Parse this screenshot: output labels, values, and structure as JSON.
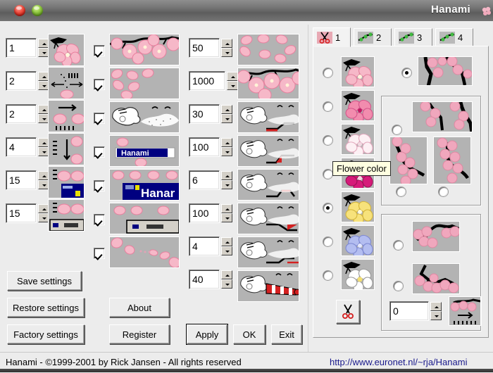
{
  "window": {
    "title": "Hanami",
    "close_label": "close",
    "minimize_label": "minimize"
  },
  "left_column": {
    "spinners": [
      {
        "name": "flowers-per-branch",
        "value": "1"
      },
      {
        "name": "wind-direction",
        "value": "2"
      },
      {
        "name": "horizontal-speed",
        "value": "2"
      },
      {
        "name": "vertical-speed",
        "value": "4"
      },
      {
        "name": "petal-size-min",
        "value": "15"
      },
      {
        "name": "petal-size-max",
        "value": "15"
      }
    ]
  },
  "middle_column": {
    "checkboxes": [
      {
        "name": "show-branches",
        "checked": true
      },
      {
        "name": "show-falling-petals",
        "checked": true
      },
      {
        "name": "show-clouds",
        "checked": true
      },
      {
        "name": "petals-on-titlebar",
        "checked": true
      },
      {
        "name": "petals-on-windows",
        "checked": true
      },
      {
        "name": "petals-on-taskbar",
        "checked": true
      },
      {
        "name": "petals-trail",
        "checked": true
      }
    ]
  },
  "right_column": {
    "spinners": [
      {
        "name": "petal-count",
        "value": "50"
      },
      {
        "name": "flower-count",
        "value": "1000"
      },
      {
        "name": "wind-gust-chance",
        "value": "30"
      },
      {
        "name": "wind-strength",
        "value": "100"
      },
      {
        "name": "gust-duration",
        "value": "6"
      },
      {
        "name": "turbulence",
        "value": "100"
      },
      {
        "name": "cloud-speed",
        "value": "4"
      },
      {
        "name": "blow-strength",
        "value": "40"
      }
    ]
  },
  "buttons": {
    "save_settings": "Save settings",
    "restore_settings": "Restore settings",
    "factory_settings": "Factory settings",
    "about": "About",
    "register": "Register",
    "apply": "Apply",
    "ok": "OK",
    "exit": "Exit"
  },
  "tabs": [
    {
      "label": "1",
      "icon": "scissors-icon",
      "active": true
    },
    {
      "label": "2",
      "icon": "green-branch-icon",
      "active": false
    },
    {
      "label": "3",
      "icon": "green-branch-icon",
      "active": false
    },
    {
      "label": "4",
      "icon": "green-branch-icon",
      "active": false
    }
  ],
  "tooltip": {
    "text": "Flower color"
  },
  "flower_colors": [
    {
      "name": "flower-color-pink",
      "color": "#f6b9c8",
      "selected": false
    },
    {
      "name": "flower-color-deep-pink",
      "color": "#f288ad",
      "selected": false
    },
    {
      "name": "flower-color-white-pink",
      "color": "#fbeef3",
      "selected": false
    },
    {
      "name": "flower-color-magenta",
      "color": "#d61b7a",
      "selected": false
    },
    {
      "name": "flower-color-yellow",
      "color": "#f7e27b",
      "selected": true
    },
    {
      "name": "flower-color-blue",
      "color": "#b3bdf0",
      "selected": false
    },
    {
      "name": "flower-color-white",
      "color": "#ffffff",
      "selected": false
    }
  ],
  "branch_top": {
    "name": "branch-style-top",
    "selected": true
  },
  "branch_group_upper": {
    "options": [
      {
        "name": "branch-style-wide",
        "selected": false
      },
      {
        "name": "branch-style-left",
        "selected": false
      },
      {
        "name": "branch-style-right",
        "selected": false
      }
    ]
  },
  "branch_group_lower": {
    "options": [
      {
        "name": "branch-style-down-right",
        "selected": false
      },
      {
        "name": "branch-style-zigzag",
        "selected": false
      }
    ],
    "offset_spinner": {
      "name": "branch-offset",
      "value": "0"
    }
  },
  "scissors_button": {
    "name": "cut-branch-button",
    "icon": "scissors-icon"
  },
  "statusbar": {
    "copyright": "Hanami -  ©1999-2001 by Rick Jansen - All rights reserved",
    "url": "http://www.euronet.nl/~rja/Hanami"
  },
  "colors": {
    "face": "#ececec",
    "thumb_bg": "#b3b3b3",
    "petal": "#f4b3c4",
    "branch": "#000000",
    "link": "#1a1a8c"
  }
}
